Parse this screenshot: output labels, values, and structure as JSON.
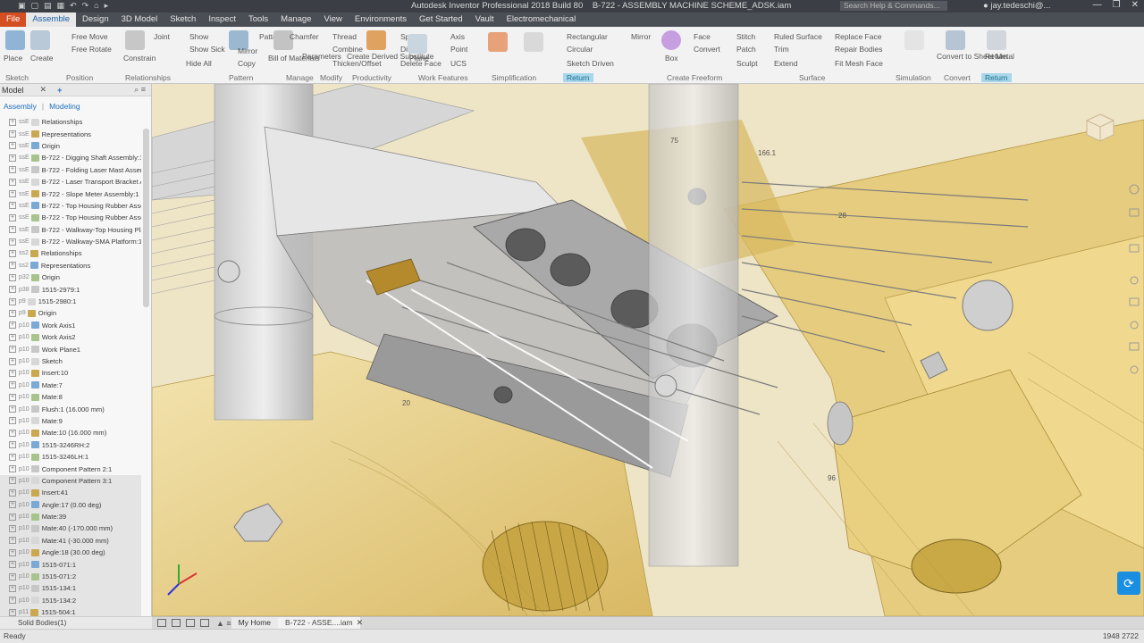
{
  "titlebar": {
    "title": "Autodesk Inventor Professional 2018 Build 80",
    "document": "B-722 - ASSEMBLY MACHINE SCHEME_ADSK.iam",
    "search_placeholder": "Search Help & Commands...",
    "user": "jay.tedeschi@..."
  },
  "tabs": [
    "File",
    "Assemble",
    "Design",
    "3D Model",
    "Sketch",
    "Inspect",
    "Tools",
    "Manage",
    "View",
    "Environments",
    "Get Started",
    "Vault",
    "Electromechanical"
  ],
  "ribbon": {
    "panels": [
      {
        "label": "Sketch"
      },
      {
        "label": "Position"
      },
      {
        "label": "Relationships"
      },
      {
        "label": "Pattern"
      },
      {
        "label": "Manage"
      },
      {
        "label": "Modify"
      },
      {
        "label": "Productivity"
      },
      {
        "label": "Work Features"
      },
      {
        "label": "Simplification"
      },
      {
        "label": "Return"
      },
      {
        "label": "Create Freeform"
      },
      {
        "label": "Surface"
      },
      {
        "label": "Simulation"
      },
      {
        "label": "Convert"
      },
      {
        "label": "Return"
      }
    ],
    "buttons": {
      "place": "Place",
      "create": "Create",
      "free_move": "Free Move",
      "free_rotate": "Free Rotate",
      "constrain": "Constrain",
      "joint": "Joint",
      "show": "Show",
      "show_sick": "Show Sick",
      "hide_all": "Hide All",
      "pattern": "Pattern",
      "mirror": "Mirror",
      "copy": "Copy",
      "bill_of_materials": "Bill of Materials",
      "parameters": "Parameters",
      "chamfer": "Chamfer",
      "thread": "Thread",
      "combine": "Combine",
      "thicken_offset": "Thicken/Offset",
      "create_derived": "Create Derived Substitute",
      "delete_face": "Delete Face",
      "split": "Split",
      "direct": "Direct",
      "plane": "Plane",
      "axis": "Axis",
      "point": "Point",
      "ucs": "UCS",
      "rectangular": "Rectangular",
      "circular": "Circular",
      "sketch_driven": "Sketch Driven",
      "box": "Box",
      "face": "Face",
      "convert": "Convert",
      "stitch": "Stitch",
      "patch": "Patch",
      "sculpt": "Sculpt",
      "ruled_surface": "Ruled Surface",
      "trim": "Trim",
      "extend": "Extend",
      "replace_face": "Replace Face",
      "repair_bodies": "Repair Bodies",
      "fit_mesh_face": "Fit Mesh Face",
      "convert_to_sheet_metal": "Convert to Sheet Metal",
      "return": "Return"
    }
  },
  "browser": {
    "header": "Model",
    "tabs": [
      "Assembly",
      "Modeling"
    ],
    "rows": [
      {
        "id": "ssE",
        "label": "Relationships"
      },
      {
        "id": "ssE",
        "label": "Representations"
      },
      {
        "id": "ssE",
        "label": "Origin"
      },
      {
        "id": "ssE",
        "label": "B-722 - Digging Shaft Assembly:1"
      },
      {
        "id": "ssE",
        "label": "B-722 - Folding Laser Mast Assembly"
      },
      {
        "id": "ssE",
        "label": "B-722 - Laser Transport Bracket Assembly"
      },
      {
        "id": "ssE",
        "label": "B-722 - Slope Meter Assembly:1"
      },
      {
        "id": "ssE",
        "label": "B-722 - Top Housing Rubber Assembly"
      },
      {
        "id": "ssE",
        "label": "B-722 - Top Housing Rubber Assembly"
      },
      {
        "id": "ssE",
        "label": "B-722 - Walkway-Top Housing Platform"
      },
      {
        "id": "ssE",
        "label": "B-722 - Walkway-SMA Platform:1"
      },
      {
        "id": "ss2",
        "label": "Relationships"
      },
      {
        "id": "ss2",
        "label": "Representations"
      },
      {
        "id": "p32",
        "label": "Origin"
      },
      {
        "id": "p38",
        "label": "1515-2979:1"
      },
      {
        "id": "p9",
        "label": "1515-2980:1"
      },
      {
        "id": "p9",
        "label": "Origin"
      },
      {
        "id": "p10",
        "label": "Work Axis1"
      },
      {
        "id": "p10",
        "label": "Work Axis2"
      },
      {
        "id": "p10",
        "label": "Work Plane1"
      },
      {
        "id": "p10",
        "label": "Sketch"
      },
      {
        "id": "p10",
        "label": "Insert:10"
      },
      {
        "id": "p10",
        "label": "Mate:7"
      },
      {
        "id": "p10",
        "label": "Mate:8"
      },
      {
        "id": "p10",
        "label": "Flush:1 (16.000 mm)"
      },
      {
        "id": "p10",
        "label": "Mate:9"
      },
      {
        "id": "p10",
        "label": "Mate:10 (16.000 mm)"
      },
      {
        "id": "p10",
        "label": "1515-3246RH:2"
      },
      {
        "id": "p10",
        "label": "1515-3246LH:1"
      },
      {
        "id": "p10",
        "label": "Component Pattern 2:1"
      },
      {
        "id": "p10",
        "label": "Component Pattern 3:1"
      },
      {
        "id": "p10",
        "label": "Insert:41"
      },
      {
        "id": "p10",
        "label": "Angle:17 (0.00 deg)"
      },
      {
        "id": "p10",
        "label": "Mate:39"
      },
      {
        "id": "p10",
        "label": "Mate:40 (-170.000 mm)"
      },
      {
        "id": "p10",
        "label": "Mate:41 (-30.000 mm)"
      },
      {
        "id": "p10",
        "label": "Angle:18 (30.00 deg)"
      },
      {
        "id": "p10",
        "label": "1515-071:1"
      },
      {
        "id": "p10",
        "label": "1515-071:2"
      },
      {
        "id": "p10",
        "label": "1515-134:1"
      },
      {
        "id": "p10",
        "label": "1515-134:2"
      },
      {
        "id": "p11",
        "label": "1515-504:1"
      }
    ],
    "footer": "Solid Bodies(1)"
  },
  "doctabs": {
    "home": "My Home",
    "active": "B-722 - ASSE....iam"
  },
  "status": {
    "ready": "Ready",
    "nums": "1948  2722"
  },
  "viewport": {
    "dims": [
      "75",
      "166.1",
      "28",
      "20",
      "96"
    ]
  }
}
